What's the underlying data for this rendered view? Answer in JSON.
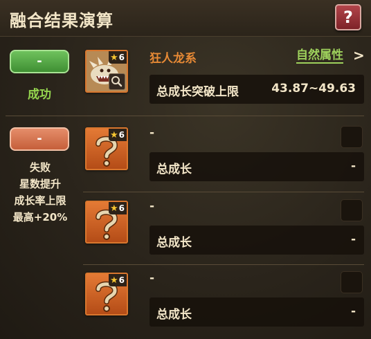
{
  "header": {
    "title": "融合结果演算",
    "help_label": "?"
  },
  "result": {
    "toggle_label": "-",
    "status": "成功",
    "monster": {
      "stars": "6",
      "name": "狂人龙系",
      "attribute": "自然属性",
      "attribute_arrow": ">"
    },
    "stat": {
      "label": "总成长突破上限",
      "value": "43.87~49.63"
    }
  },
  "materials": {
    "toggle_label": "-",
    "fail_lines": [
      "失败",
      "星数提升",
      "成长率上限",
      "最高+20%"
    ],
    "items": [
      {
        "stars": "6",
        "name": "-",
        "stat_label": "总成长",
        "stat_value": "-"
      },
      {
        "stars": "6",
        "name": "-",
        "stat_label": "总成长",
        "stat_value": "-"
      },
      {
        "stars": "6",
        "name": "-",
        "stat_label": "总成长",
        "stat_value": "-"
      }
    ]
  },
  "colors": {
    "accent_orange": "#e88a35",
    "success_green": "#95d64f",
    "attribute_green": "#9ed15c"
  },
  "icons": [
    "help-icon",
    "star-icon",
    "magnifier-icon",
    "question-mark-icon",
    "chevron-right-icon"
  ]
}
